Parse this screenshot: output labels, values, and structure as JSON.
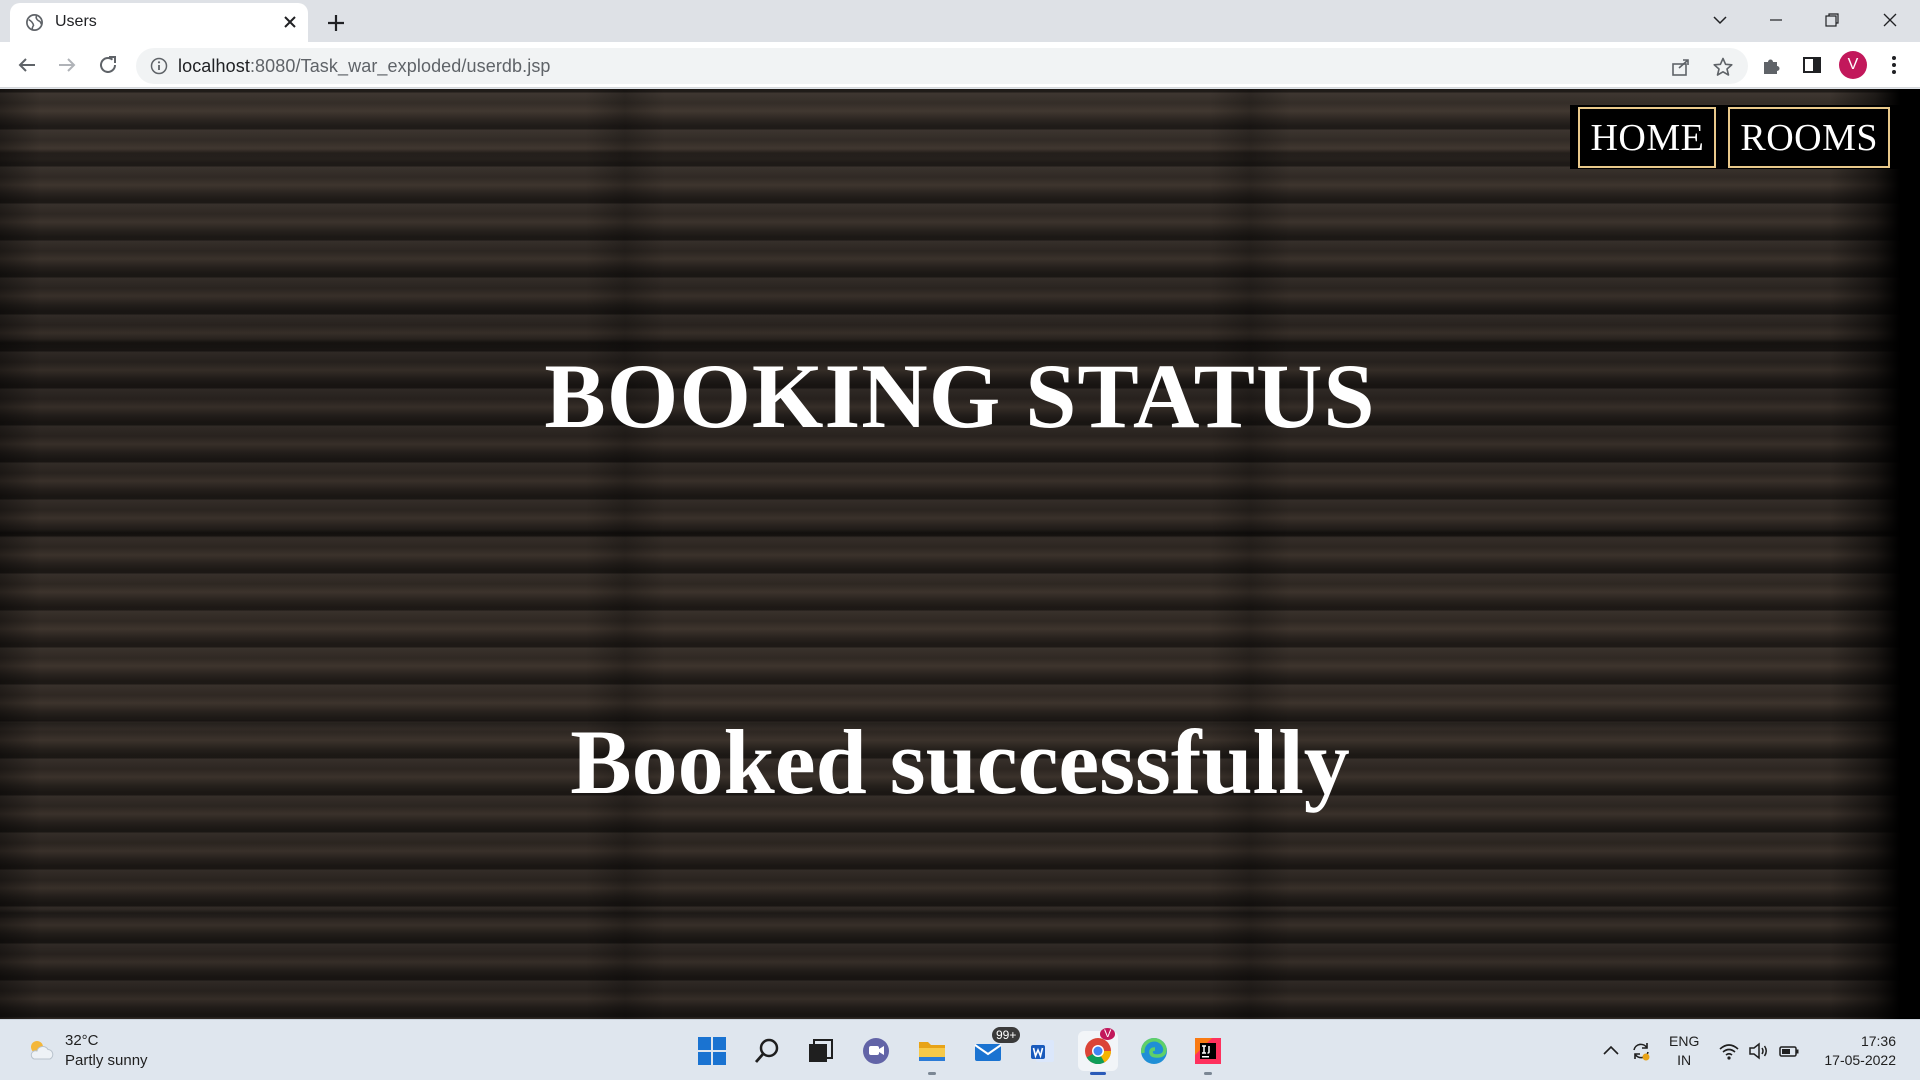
{
  "browser": {
    "tab_title": "Users",
    "url_host": "localhost",
    "url_path": ":8080/Task_war_exploded/userdb.jsp",
    "profile_initial": "V",
    "profile_color": "#c2185b"
  },
  "page": {
    "nav": [
      {
        "label": "HOME"
      },
      {
        "label": "ROOMS"
      }
    ],
    "title": "BOOKING STATUS",
    "message": "Booked successfully",
    "nav_border_color": "#e8c88a"
  },
  "taskbar": {
    "weather_temp": "32°C",
    "weather_desc": "Partly sunny",
    "mail_badge": "99+",
    "chrome_badge": "V",
    "lang_line1": "ENG",
    "lang_line2": "IN",
    "time": "17:36",
    "date": "17-05-2022",
    "apps": [
      "start",
      "search",
      "task-view",
      "teams-chat",
      "file-explorer",
      "mail",
      "word",
      "chrome",
      "edge",
      "intellij"
    ]
  }
}
